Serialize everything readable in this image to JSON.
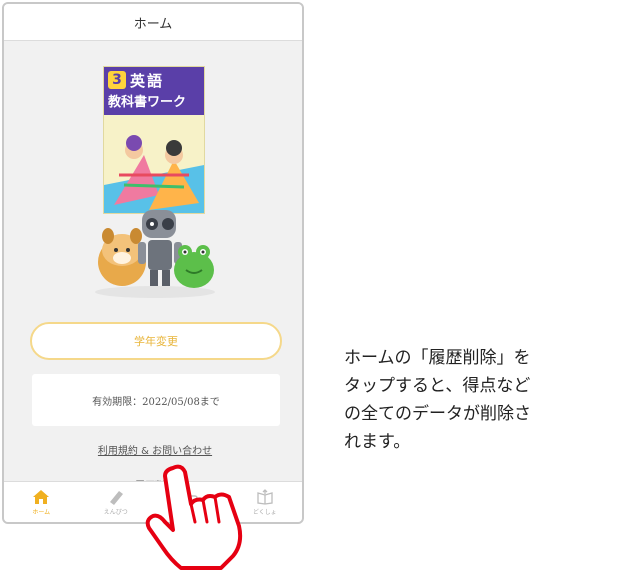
{
  "header": {
    "title": "ホーム"
  },
  "book": {
    "grade": "3",
    "subject": "英語",
    "title": "教科書ワーク"
  },
  "grade_change": {
    "label": "学年変更"
  },
  "expiry": {
    "text": "有効期限：2022/05/08まで"
  },
  "links": {
    "terms": "利用規約 & お問い合わせ",
    "delete_history": "履歴削除"
  },
  "tabs": [
    {
      "label": "ホーム",
      "icon": "home-icon",
      "active": true
    },
    {
      "label": "えんぴつ",
      "icon": "pencil-icon",
      "active": false
    },
    {
      "label": "",
      "icon": "chat-icon",
      "active": false
    },
    {
      "label": "どくしょ",
      "icon": "book-icon",
      "active": false
    }
  ],
  "caption": "ホームの「履歴削除」を\nタップすると、得点など\nの全てのデータが削除さ\nれます。",
  "colors": {
    "accent": "#f0b020",
    "button_border": "#f5d88a",
    "hand": "#e60012"
  }
}
